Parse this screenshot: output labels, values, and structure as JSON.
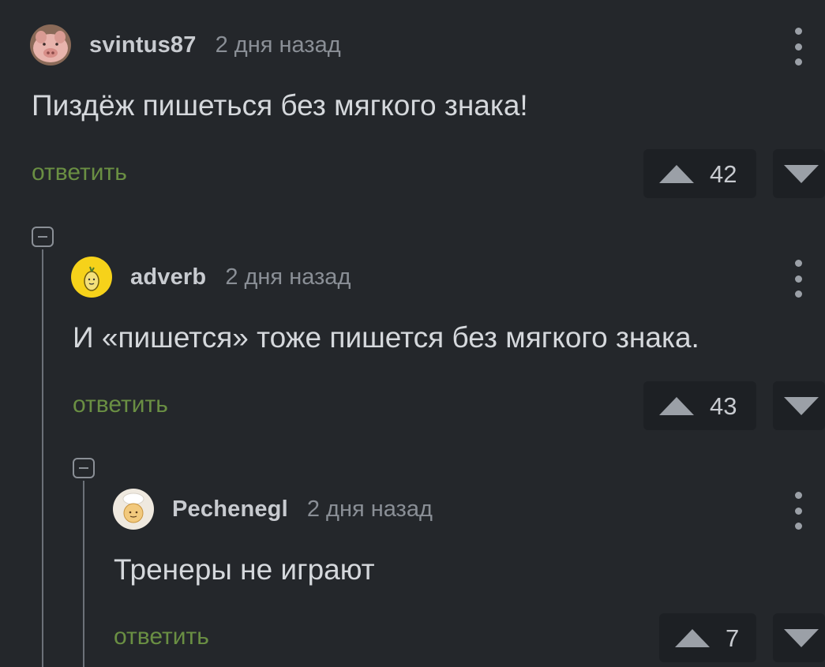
{
  "comments": [
    {
      "author": "svintus87",
      "time": "2 дня назад",
      "text": "Пиздёж пишеться без мягкого знака!",
      "reply_label": "ответить",
      "score": "42"
    },
    {
      "author": "adverb",
      "time": "2 дня назад",
      "text": "И «пишется» тоже пишется без мягкого знака.",
      "reply_label": "ответить",
      "score": "43"
    },
    {
      "author": "Pechenegl",
      "time": "2 дня назад",
      "text": "Тренеры не играют",
      "reply_label": "ответить",
      "score": "7"
    }
  ],
  "icons": {
    "menu": "more-vertical-icon",
    "upvote": "triangle-up-icon",
    "downvote": "triangle-down-icon",
    "collapse": "minus-square-icon"
  },
  "colors": {
    "background": "#24272b",
    "reply": "#6a8f43",
    "vote_box": "#1d2024"
  }
}
